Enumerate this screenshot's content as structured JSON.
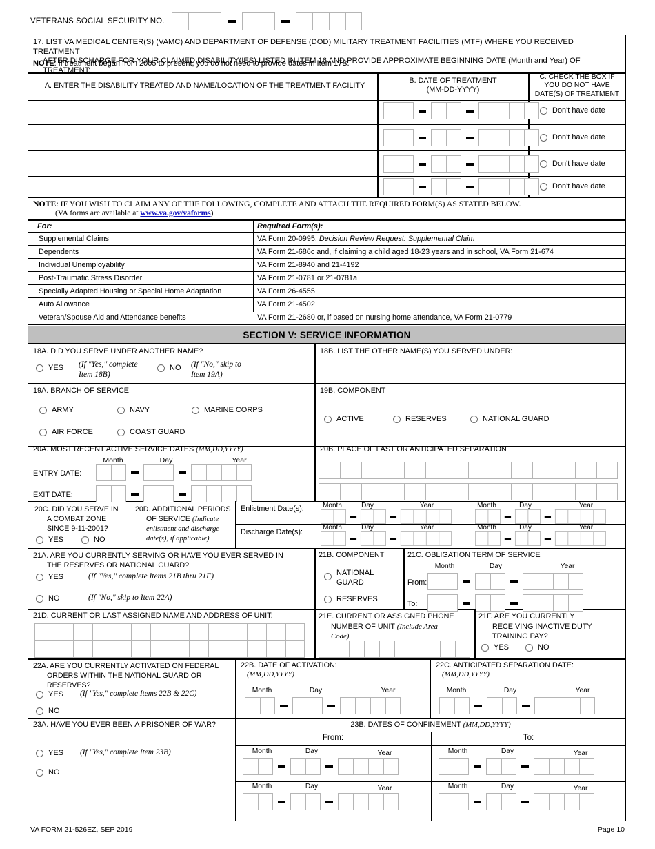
{
  "header": {
    "ssn_label": "VETERANS SOCIAL SECURITY NO.",
    "ssn_groups": [
      3,
      2,
      4
    ]
  },
  "item17": {
    "number": "17.",
    "text_line1": "LIST VA MEDICAL CENTER(S) (VAMC) AND DEPARTMENT OF DEFENSE (DOD) MILITARY TREATMENT FACILITIES (MTF) WHERE YOU RECEIVED TREATMENT",
    "text_line2": "AFTER DISCHARGE FOR YOUR CLAIMED DISABILITY(IES) LISTED IN ITEM 16 AND PROVIDE APPROXIMATE BEGINNING DATE (Month and Year) OF TREATMENT:",
    "note_label": "NOTE",
    "note_text": ": If treatment began from 2005 to present, you do not need to provide dates in Item 17B.",
    "col_a": "A. ENTER THE DISABILITY TREATED AND NAME/LOCATION OF THE TREATMENT FACILITY",
    "col_b_line1": "B. DATE OF TREATMENT",
    "col_b_line2": "(MM-DD-YYYY)",
    "col_c_line1": "C. CHECK THE BOX IF",
    "col_c_line2": "YOU DO NOT HAVE",
    "col_c_line3": "DATE(S) OF TREATMENT",
    "rows": [
      {
        "facility": "",
        "no_date_label": "Don't have date"
      },
      {
        "facility": "",
        "no_date_label": "Don't have date"
      },
      {
        "facility": "",
        "no_date_label": "Don't have date"
      },
      {
        "facility": "",
        "no_date_label": "Don't have date"
      }
    ]
  },
  "forms_note": {
    "note_label": "NOTE",
    "note_text": ":  IF YOU WISH TO CLAIM ANY OF THE FOLLOWING, COMPLETE AND ATTACH THE REQUIRED FORM(S) AS STATED BELOW.",
    "sub_prefix": "(VA forms are available at  ",
    "link": "www.va.gov/vaforms",
    "sub_suffix": ")",
    "col_for": "For:",
    "col_required": "Required Form(s):",
    "rows": [
      {
        "for": "Supplemental Claims",
        "form_plain": "VA Form 20-0995, ",
        "form_italic": "Decision Review Request: Supplemental Claim"
      },
      {
        "for": "Dependents",
        "form_plain": "VA Form 21-686c and, if claiming a child aged 18-23 years and in school, VA Form 21-674",
        "form_italic": ""
      },
      {
        "for": "Individual Unemployability",
        "form_plain": "VA Form 21-8940 and 21-4192",
        "form_italic": ""
      },
      {
        "for": "Post-Traumatic Stress Disorder",
        "form_plain": "VA Form 21-0781 or 21-0781a",
        "form_italic": ""
      },
      {
        "for": "Specially Adapted Housing or Special Home Adaptation",
        "form_plain": "VA Form 26-4555",
        "form_italic": ""
      },
      {
        "for": "Auto Allowance",
        "form_plain": "VA Form 21-4502",
        "form_italic": ""
      },
      {
        "for": "Veteran/Spouse Aid and Attendance benefits",
        "form_plain": "VA Form 21-2680 or, if based on nursing home attendance, VA Form 21-0779",
        "form_italic": ""
      }
    ]
  },
  "section_v": {
    "title": "SECTION V: SERVICE INFORMATION",
    "bg": "#bfbfbf"
  },
  "item18a": {
    "label": "18A. DID YOU SERVE UNDER ANOTHER NAME?",
    "yes": "YES",
    "yes_hint_l1": "(If \"Yes,\" complete",
    "yes_hint_l2": "Item 18B)",
    "no": "NO",
    "no_hint_l1": "(If \"No,\" skip to",
    "no_hint_l2": "Item 19A)"
  },
  "item18b": {
    "label": "18B. LIST THE OTHER NAME(S) YOU SERVED UNDER:"
  },
  "item19a": {
    "label": "19A. BRANCH OF SERVICE",
    "options": [
      "ARMY",
      "NAVY",
      "MARINE CORPS",
      "AIR FORCE",
      "COAST GUARD"
    ]
  },
  "item19b": {
    "label": "19B. COMPONENT",
    "options": [
      "ACTIVE",
      "RESERVES",
      "NATIONAL GUARD"
    ]
  },
  "item20a": {
    "label": "20A. MOST RECENT ACTIVE SERVICE DATES ",
    "label_italic": "(MM,DD,YYYY)",
    "col_month": "Month",
    "col_day": "Day",
    "col_year": "Year",
    "entry_label": "ENTRY DATE:",
    "exit_label": "EXIT DATE:"
  },
  "item20b": {
    "label": "20B. PLACE OF LAST OR ANTICIPATED SEPARATION",
    "boxes_per_row": 14,
    "rows": 2
  },
  "item20c": {
    "line1": "20C. DID YOU SERVE IN",
    "line2": "A COMBAT ZONE",
    "line3": "SINCE 9-11-2001?",
    "yes": "YES",
    "no": "NO"
  },
  "item20d": {
    "line1": "20D. ADDITIONAL PERIODS",
    "line2": "OF SERVICE ",
    "line2_italic": "(Indicate",
    "line3_italic": "enlistment and discharge",
    "line4_italic": "date(s), if applicable)",
    "enlistment_label": "Enlistment Date(s):",
    "discharge_label": "Discharge Date(s):",
    "col_month": "Month",
    "col_day": "Day",
    "col_year": "Year"
  },
  "item21a": {
    "line1": "21A. ARE YOU CURRENTLY SERVING OR HAVE YOU EVER SERVED IN",
    "line2": "THE RESERVES OR NATIONAL GUARD?",
    "yes": "YES",
    "yes_hint": "(If \"Yes,\" complete Items 21B thru 21F)",
    "no": "NO",
    "no_hint": "(If \"No,\" skip to Item 22A)"
  },
  "item21b": {
    "label": "21B. COMPONENT",
    "opt1_l1": "NATIONAL",
    "opt1_l2": "GUARD",
    "opt2": "RESERVES"
  },
  "item21c": {
    "label": "21C. OBLIGATION TERM OF SERVICE",
    "col_month": "Month",
    "col_day": "Day",
    "col_year": "Year",
    "from_label": "From:",
    "to_label": "To:"
  },
  "item21d": {
    "label": "21D. CURRENT OR LAST ASSIGNED NAME AND ADDRESS OF UNIT:",
    "boxes_per_row": 14,
    "rows": 2
  },
  "item21e": {
    "line1": "21E. CURRENT OR ASSIGNED PHONE",
    "line2": "NUMBER OF UNIT ",
    "line2_italic": "(Include Area",
    "line3_italic": "Code)",
    "boxes": 10
  },
  "item21f": {
    "line1": "21F. ARE YOU CURRENTLY",
    "line2": "RECEIVING INACTIVE DUTY",
    "line3": "TRAINING PAY?",
    "yes": "YES",
    "no": "NO"
  },
  "item22a": {
    "line1": "22A. ARE YOU CURRENTLY ACTIVATED ON FEDERAL",
    "line2": "ORDERS WITHIN THE NATIONAL GUARD OR",
    "line3": "RESERVES?",
    "yes": "YES",
    "yes_hint": "(If \"Yes,\" complete Items 22B & 22C)",
    "no": "NO"
  },
  "item22b": {
    "label": "22B. DATE OF ACTIVATION:",
    "label_italic": "(MM,DD,YYYY)",
    "col_month": "Month",
    "col_day": "Day",
    "col_year": "Year"
  },
  "item22c": {
    "label": "22C. ANTICIPATED SEPARATION DATE:",
    "label_italic": "(MM,DD,YYYY)",
    "col_month": "Month",
    "col_day": "Day",
    "col_year": "Year"
  },
  "item23a": {
    "label": "23A. HAVE YOU EVER BEEN A PRISONER OF WAR?",
    "yes": "YES",
    "yes_hint": "(If \"Yes,\" complete Item 23B)",
    "no": "NO"
  },
  "item23b": {
    "label": "23B. DATES OF CONFINEMENT ",
    "label_italic": "(MM,DD,YYYY)",
    "from_label": "From:",
    "to_label": "To:",
    "col_month": "Month",
    "col_day": "Day",
    "col_year": "Year"
  },
  "footer": {
    "form_id": "VA FORM 21-526EZ, SEP 2019",
    "page": "Page 10"
  }
}
